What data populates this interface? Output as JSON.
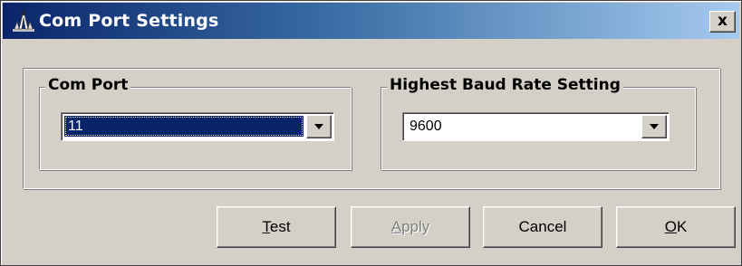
{
  "window": {
    "title": "Com Port Settings",
    "close_label": "x",
    "icon": "antenna-tower-icon"
  },
  "com_port": {
    "legend": "Com Port",
    "selected": "11"
  },
  "baud_rate": {
    "legend": "Highest Baud Rate Setting",
    "selected": "9600"
  },
  "buttons": {
    "test": {
      "mnemonic": "T",
      "rest": "est",
      "enabled": true
    },
    "apply": {
      "mnemonic": "A",
      "rest": "pply",
      "enabled": false
    },
    "cancel": {
      "label": "Cancel",
      "enabled": true
    },
    "ok": {
      "mnemonic": "O",
      "rest": "K",
      "enabled": true
    }
  },
  "colors": {
    "title_gradient_start": "#0a246a",
    "title_gradient_end": "#a6caf0",
    "face": "#d4d0c8",
    "selection": "#0a246a"
  }
}
